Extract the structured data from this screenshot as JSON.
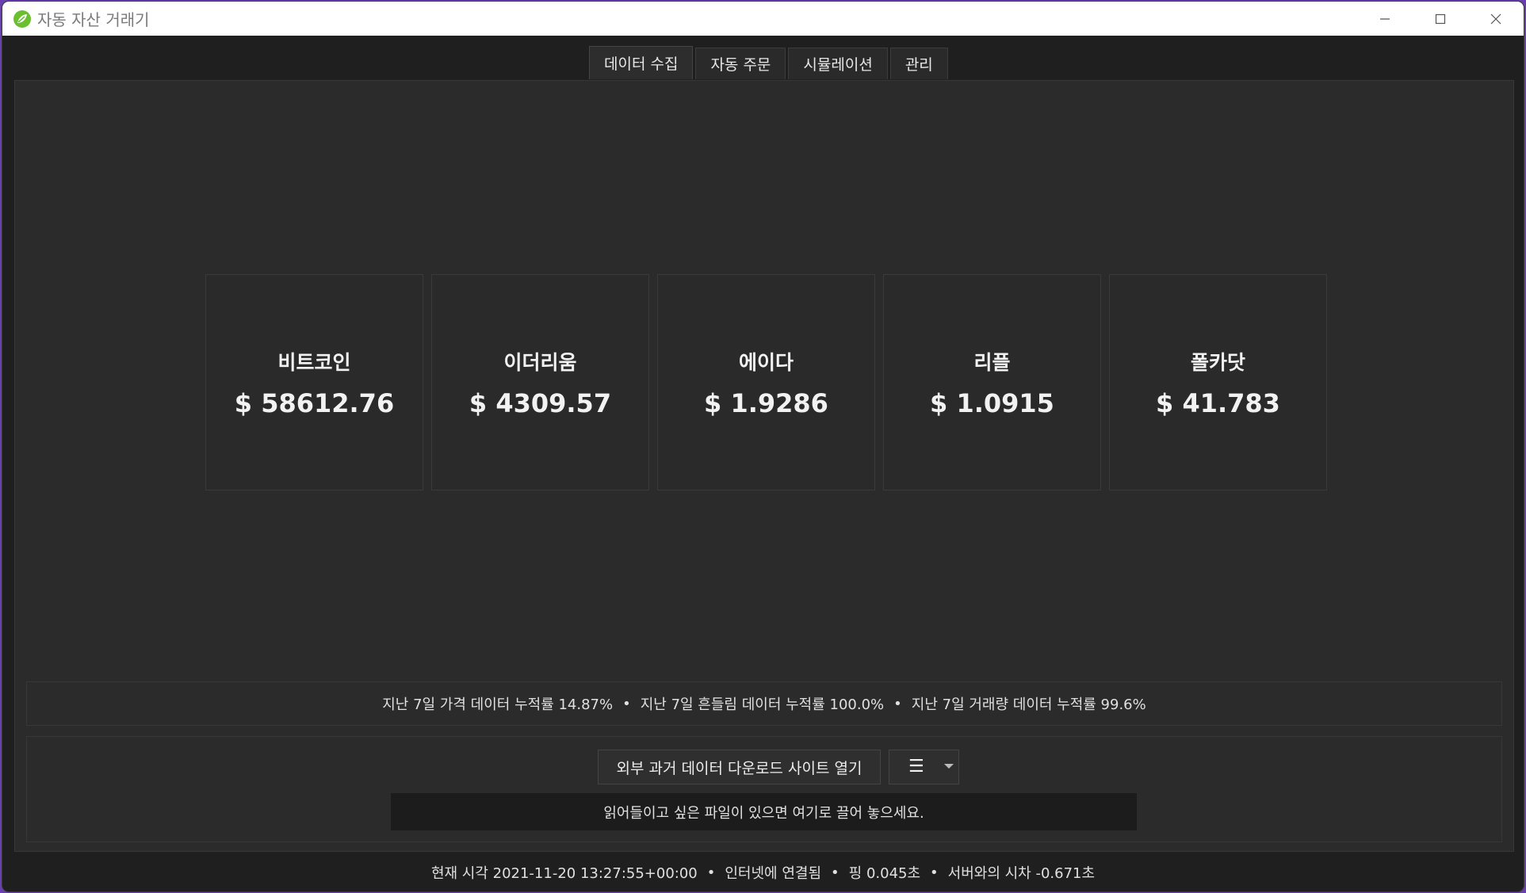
{
  "window": {
    "title": "자동 자산 거래기",
    "app_icon": "leaf-logo-icon",
    "controls": [
      "minimize-icon",
      "maximize-icon",
      "close-icon"
    ]
  },
  "tabs": [
    {
      "label": "데이터 수집",
      "active": true
    },
    {
      "label": "자동 주문",
      "active": false
    },
    {
      "label": "시뮬레이션",
      "active": false
    },
    {
      "label": "관리",
      "active": false
    }
  ],
  "cards": [
    {
      "name": "비트코인",
      "price": "$ 58612.76"
    },
    {
      "name": "이더리움",
      "price": "$ 4309.57"
    },
    {
      "name": "에이다",
      "price": "$ 1.9286"
    },
    {
      "name": "리플",
      "price": "$ 1.0915"
    },
    {
      "name": "폴카닷",
      "price": "$ 41.783"
    }
  ],
  "stats": {
    "price_data": "지난 7일 가격 데이터 누적률 14.87%",
    "volatility_data": "지난 7일 흔들림 데이터 누적률 100.0%",
    "volume_data": "지난 7일 거래량 데이터 누적률 99.6%",
    "separator": "•"
  },
  "bottom": {
    "download_button": "외부 과거 데이터 다운로드 사이트 열기",
    "menu_icon": "hamburger-menu-icon",
    "dropzone_text": "읽어들이고 싶은 파일이 있으면 여기로 끌어 놓으세요."
  },
  "status": {
    "time": "현재 시각 2021-11-20 13:27:55+00:00",
    "connection": "인터넷에 연결됨",
    "ping": "핑 0.045초",
    "server_offset": "서버와의 시차 -0.671초"
  },
  "colors": {
    "background": "#1f1f1f",
    "panel": "#2b2b2b",
    "text": "#e8e8e8",
    "accent_logo": "#6abf2e"
  }
}
